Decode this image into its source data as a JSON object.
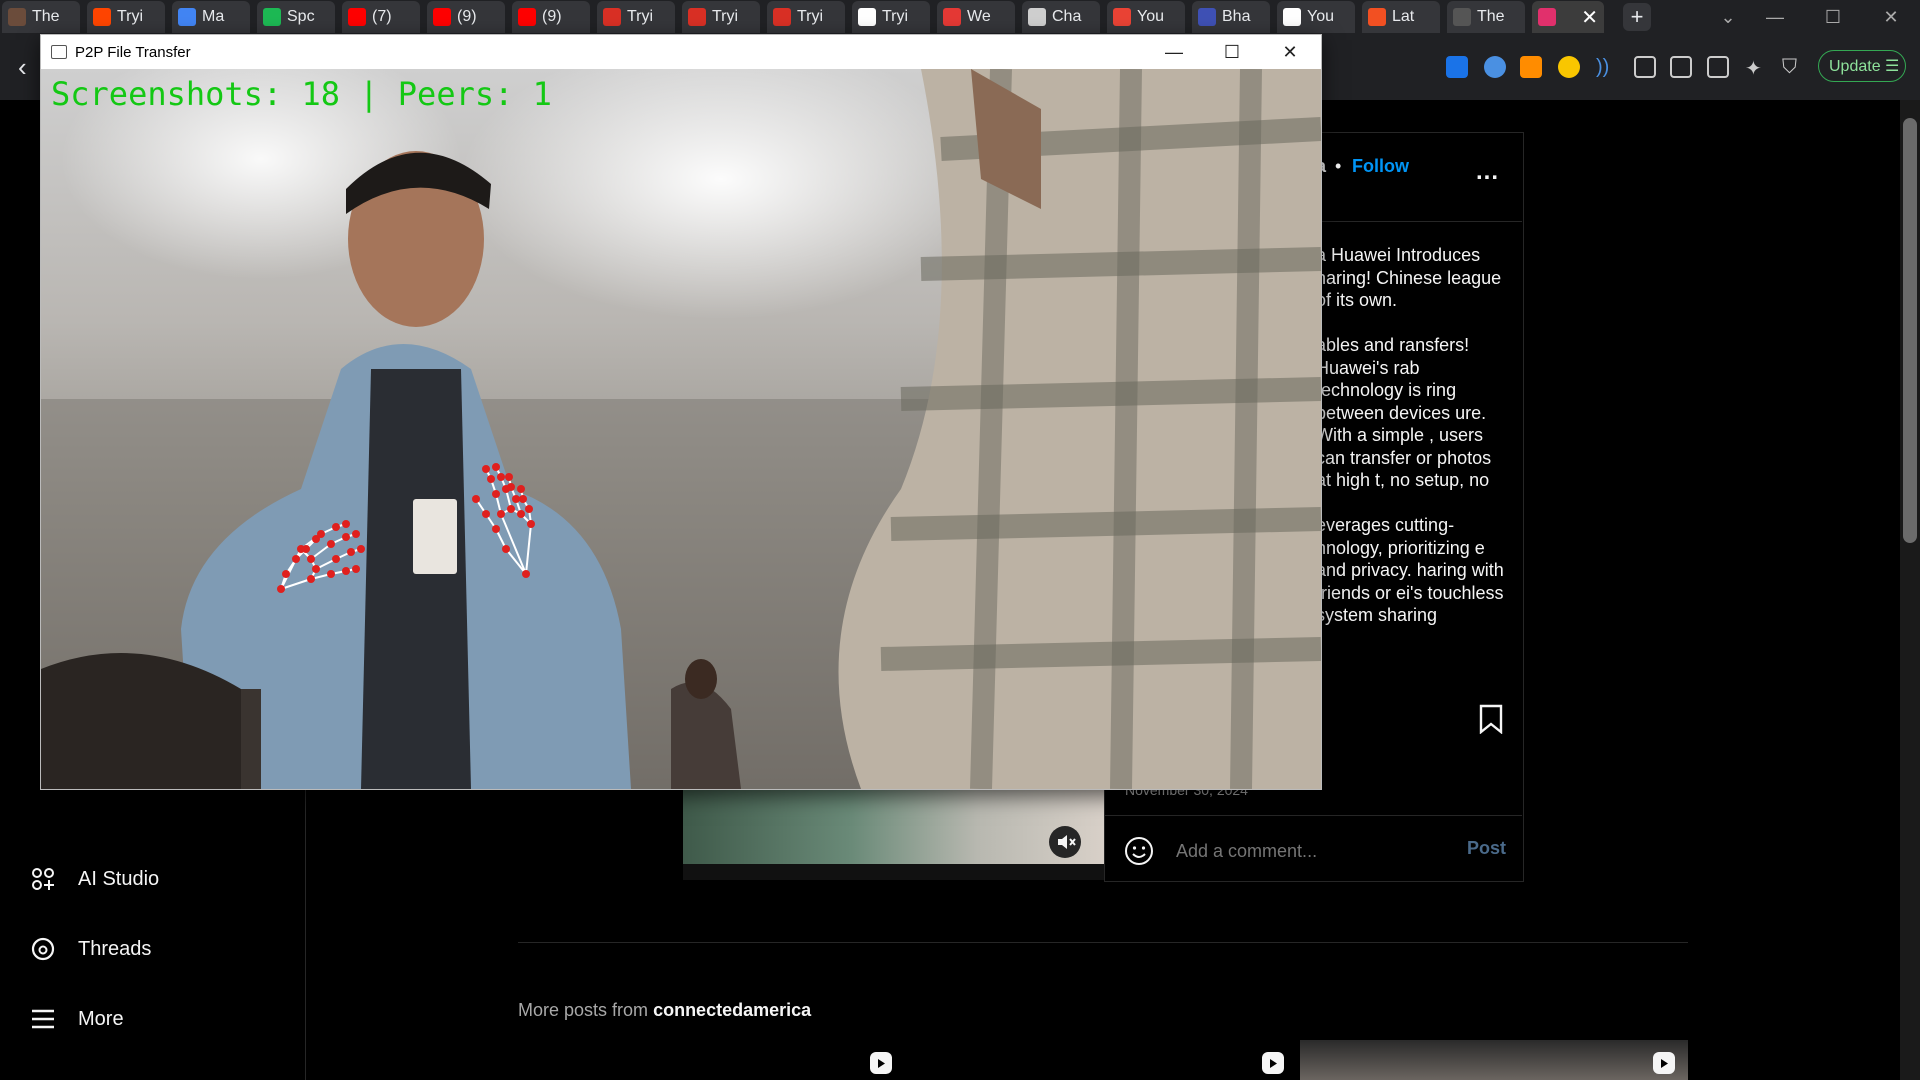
{
  "browser": {
    "tabs": [
      {
        "label": "The",
        "color": "#6b4c3b"
      },
      {
        "label": "Tryi",
        "color": "#ff4500"
      },
      {
        "label": "Ma",
        "color": "#4285f4"
      },
      {
        "label": "Spc",
        "color": "#1db954"
      },
      {
        "label": "(7)",
        "color": "#ff0000"
      },
      {
        "label": "(9)",
        "color": "#ff0000"
      },
      {
        "label": "(9)",
        "color": "#ff0000"
      },
      {
        "label": "Tryi",
        "color": "#d93025"
      },
      {
        "label": "Tryi",
        "color": "#d93025"
      },
      {
        "label": "Tryi",
        "color": "#d93025"
      },
      {
        "label": "Tryi",
        "color": "#ffffff"
      },
      {
        "label": "We",
        "color": "#e53935"
      },
      {
        "label": "Cha",
        "color": "#cfcfcf"
      },
      {
        "label": "You",
        "color": "#ea4335"
      },
      {
        "label": "Bha",
        "color": "#3f51b5"
      },
      {
        "label": "You",
        "color": "#ffffff"
      },
      {
        "label": "Lat",
        "color": "#f25022"
      },
      {
        "label": "The",
        "color": "#555555"
      },
      {
        "label": "",
        "color": "#e1306c"
      }
    ],
    "new_tab_label": "+",
    "update_label": "Update",
    "back_icon": "chevron-left-icon"
  },
  "sidebar": {
    "items": [
      {
        "label": "AI Studio",
        "icon": "ai-studio-icon"
      },
      {
        "label": "Threads",
        "icon": "threads-icon"
      },
      {
        "label": "More",
        "icon": "menu-icon"
      }
    ]
  },
  "post": {
    "username_fragment": "a",
    "separator": "•",
    "follow_label": "Follow",
    "more_label": "...",
    "caption_paragraphs": [
      "a Huawei Introduces haring! Chinese league of its own.",
      "ables and ransfers! Huawei's rab technology is ring between devices ure. With a simple , users can transfer or photos at high t, no setup, no",
      "everages cutting- hnology, prioritizing e and privacy. haring with friends or ei's touchless system sharing"
    ],
    "date": "November 30, 2024",
    "comment_placeholder": "Add a comment...",
    "post_label": "Post"
  },
  "more_posts": {
    "prefix": "More posts from",
    "account": "connectedamerica"
  },
  "p2p_window": {
    "title": "P2P File Transfer",
    "minimize": "—",
    "maximize": "☐",
    "close": "✕",
    "overlay_text": "Screenshots: 18 | Peers: 1",
    "overlay_color": "#14c814",
    "landmark_color": "#e0201e"
  }
}
